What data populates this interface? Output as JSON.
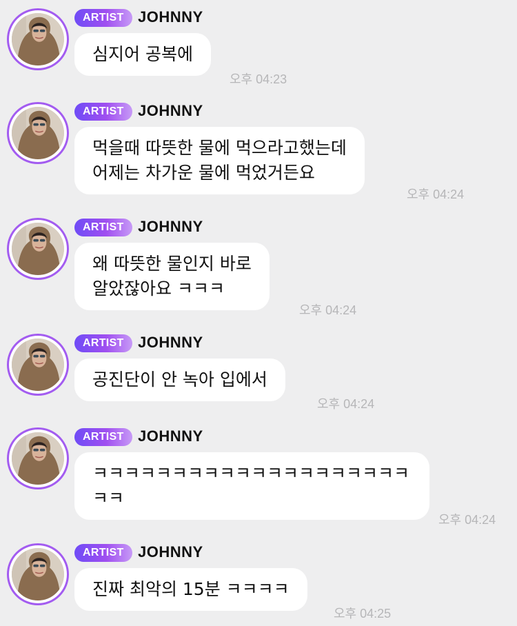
{
  "messages": [
    {
      "badge": "ARTIST",
      "author": "JOHNNY",
      "lines": [
        "심지어 공복에"
      ],
      "time": "오후 04:23"
    },
    {
      "badge": "ARTIST",
      "author": "JOHNNY",
      "lines": [
        "먹을때 따뜻한 물에 먹으라고했는데",
        "어제는 차가운 물에 먹었거든요"
      ],
      "time": "오후 04:24"
    },
    {
      "badge": "ARTIST",
      "author": "JOHNNY",
      "lines": [
        "왜 따뜻한 물인지 바로",
        "알았잖아요 ㅋㅋㅋ"
      ],
      "time": "오후 04:24"
    },
    {
      "badge": "ARTIST",
      "author": "JOHNNY",
      "lines": [
        "공진단이 안 녹아 입에서"
      ],
      "time": "오후 04:24"
    },
    {
      "badge": "ARTIST",
      "author": "JOHNNY",
      "lines": [
        "ㅋㅋㅋㅋㅋㅋㅋㅋㅋㅋㅋㅋㅋㅋㅋㅋㅋㅋㅋㅋ",
        "ㅋㅋ"
      ],
      "time": "오후 04:24"
    },
    {
      "badge": "ARTIST",
      "author": "JOHNNY",
      "lines": [
        "진짜 최악의 15분 ㅋㅋㅋㅋ"
      ],
      "time": "오후 04:25"
    }
  ]
}
